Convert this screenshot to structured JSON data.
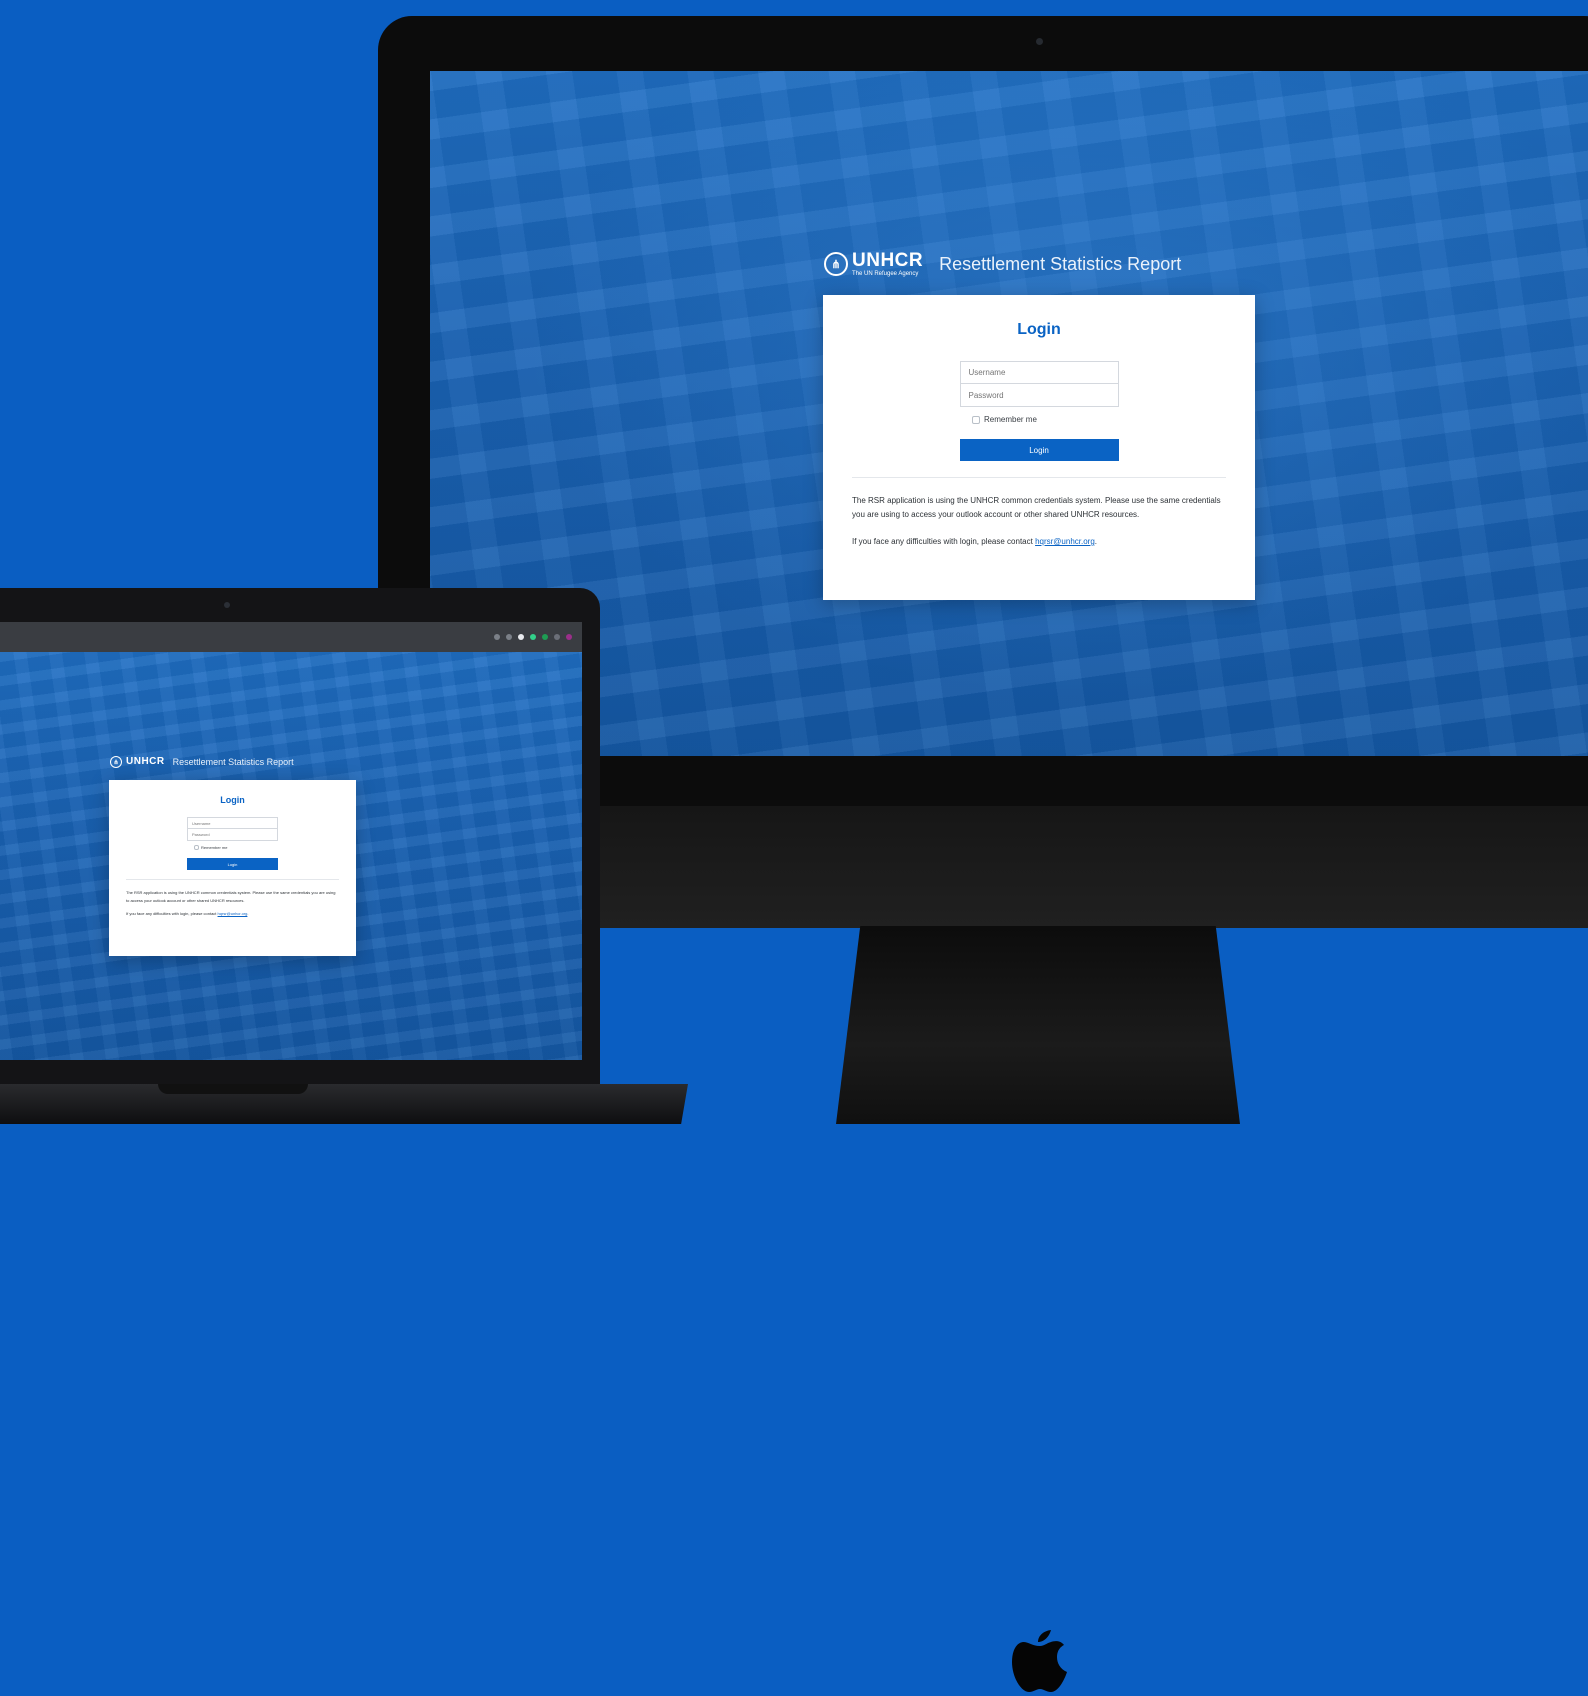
{
  "brand": {
    "org_name": "UNHCR",
    "org_tagline": "The UN Refugee Agency",
    "app_title": "Resettlement Statistics Report"
  },
  "login": {
    "heading": "Login",
    "username_placeholder": "Username",
    "password_placeholder": "Password",
    "remember_label": "Remember me",
    "button_label": "Login",
    "info_text": "The RSR application is using the UNHCR common credentials system. Please use the same credentials you are using to access your outlook account or other shared UNHCR resources.",
    "contact_text": "If you face any difficulties with login, please contact ",
    "contact_email": "hqrsr@unhcr.org",
    "contact_suffix": "."
  },
  "colors": {
    "background": "#0a5ec2",
    "accent": "#0a63c4",
    "card": "#ffffff"
  }
}
